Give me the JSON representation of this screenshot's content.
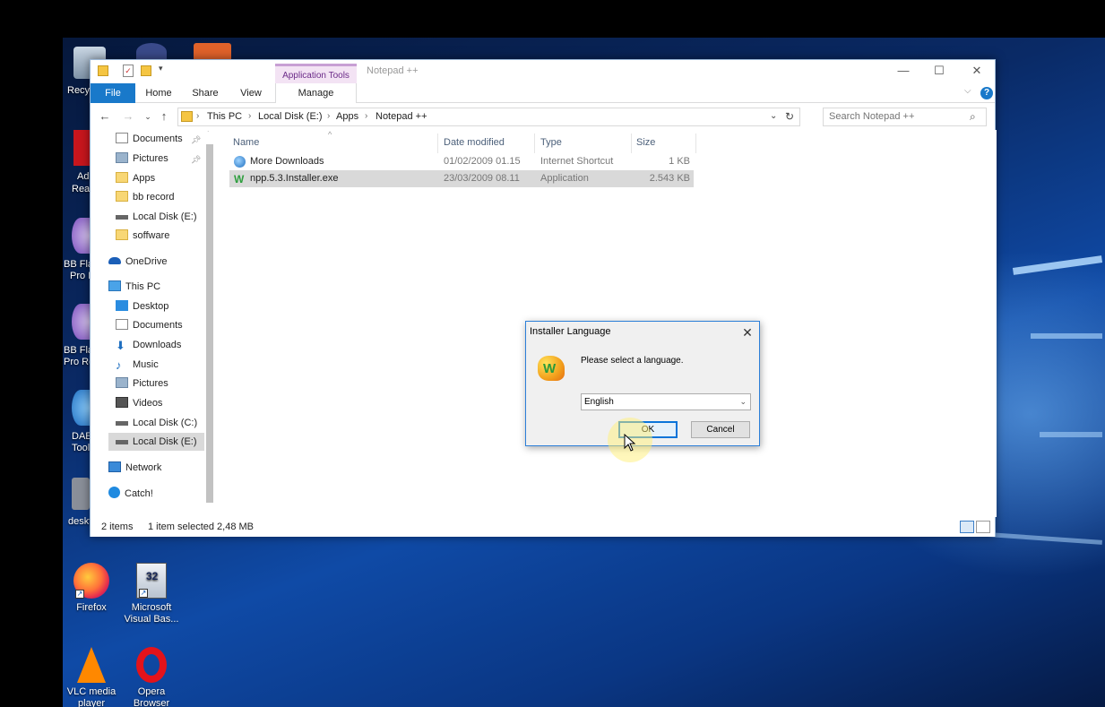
{
  "explorer": {
    "title": "Notepad ++",
    "contextual_tab": "Application Tools",
    "tabs": [
      "File",
      "Home",
      "Share",
      "View",
      "Manage"
    ],
    "breadcrumb": [
      "This PC",
      "Local Disk (E:)",
      "Apps",
      "Notepad ++"
    ],
    "search_placeholder": "Search Notepad ++",
    "nav": {
      "quick_access": [
        {
          "label": "Documents",
          "icon": "documents-icon",
          "pinned": true
        },
        {
          "label": "Pictures",
          "icon": "pictures-icon",
          "pinned": true
        },
        {
          "label": "Apps",
          "icon": "folder-icon"
        },
        {
          "label": "bb record",
          "icon": "folder-icon"
        },
        {
          "label": "Local Disk (E:)",
          "icon": "drive-icon"
        },
        {
          "label": "soffware",
          "icon": "folder-icon"
        }
      ],
      "onedrive": "OneDrive",
      "this_pc": "This PC",
      "this_pc_items": [
        {
          "label": "Desktop",
          "icon": "desktop-icon"
        },
        {
          "label": "Documents",
          "icon": "documents-icon"
        },
        {
          "label": "Downloads",
          "icon": "downloads-icon"
        },
        {
          "label": "Music",
          "icon": "music-icon"
        },
        {
          "label": "Pictures",
          "icon": "pictures-icon"
        },
        {
          "label": "Videos",
          "icon": "videos-icon"
        },
        {
          "label": "Local Disk (C:)",
          "icon": "drive-icon"
        },
        {
          "label": "Local Disk (E:)",
          "icon": "drive-icon",
          "selected": true
        }
      ],
      "network": "Network",
      "catch": "Catch!"
    },
    "columns": [
      "Name",
      "Date modified",
      "Type",
      "Size"
    ],
    "files": [
      {
        "name": "More Downloads",
        "date": "01/02/2009 01.15",
        "type": "Internet Shortcut",
        "size": "1 KB",
        "selected": false
      },
      {
        "name": "npp.5.3.Installer.exe",
        "date": "23/03/2009 08.11",
        "type": "Application",
        "size": "2.543 KB",
        "selected": true
      }
    ],
    "status": {
      "items": "2 items",
      "selection": "1 item selected  2,48 MB"
    }
  },
  "dialog": {
    "title": "Installer Language",
    "prompt": "Please select a language.",
    "selected_language": "English",
    "ok": "OK",
    "cancel": "Cancel"
  },
  "desktop": {
    "icons": [
      {
        "label": "Firefox"
      },
      {
        "label": "Microsoft Visual Bas..."
      },
      {
        "label": "VLC media player"
      },
      {
        "label": "Opera Browser"
      }
    ],
    "partial_labels": [
      "Recy",
      "Ad",
      "Rea",
      "BB Fla",
      "Pro I",
      "BB Fla",
      "Pro Re",
      "DAE",
      "Tool",
      "deskt"
    ]
  }
}
